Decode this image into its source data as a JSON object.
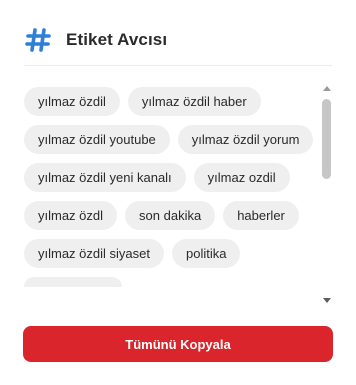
{
  "header": {
    "icon": "hash-icon",
    "title": "Etiket Avcısı"
  },
  "tags": [
    "yılmaz özdil",
    "yılmaz özdil haber",
    "yılmaz özdil youtube",
    "yılmaz özdil yorum",
    "yılmaz özdil yeni kanalı",
    "yılmaz ozdil",
    "yılmaz özdl",
    "son dakika",
    "haberler",
    "yılmaz özdil siyaset",
    "politika"
  ],
  "copy_button": {
    "label": "Tümünü Kopyala"
  },
  "colors": {
    "accent_blue": "#2f7fd6",
    "button_red": "#d9252b",
    "tag_bg": "#efefef"
  }
}
